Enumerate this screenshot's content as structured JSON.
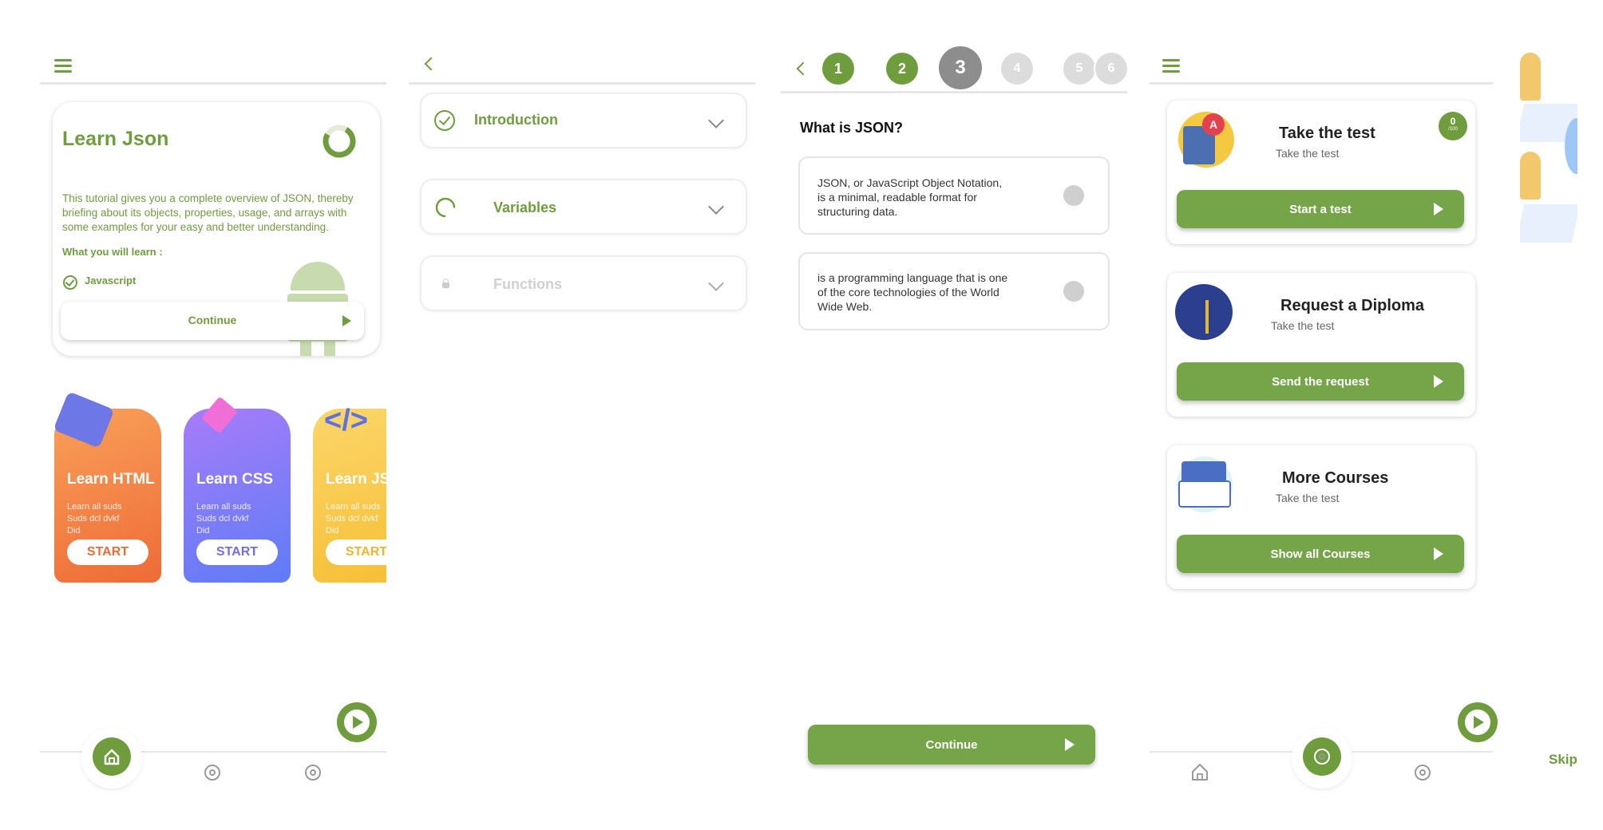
{
  "colors": {
    "accent": "#6f9d3d",
    "button": "#75a548",
    "html_card": "#f07a3c",
    "css_card": "#7c6cf7",
    "js_card": "#f7c844"
  },
  "screen1": {
    "hero": {
      "title": "Learn Json",
      "description": "This tutorial gives you a complete overview of JSON, thereby briefing about its objects, properties, usage, and arrays with some examples for your easy and better understanding.",
      "learn_heading": "What you will learn :",
      "learn_item": "Javascript",
      "continue_label": "Continue"
    },
    "courses": [
      {
        "title": "Learn HTML",
        "desc1": "Learn all suds",
        "desc2": "Suds dcl dvkf",
        "desc3": "Did",
        "start": "START"
      },
      {
        "title": "Learn CSS",
        "desc1": "Learn all suds",
        "desc2": "Suds dcl dvkf",
        "desc3": "Did",
        "start": "START"
      },
      {
        "title": "Learn JS",
        "desc1": "Learn all suds",
        "desc2": "Suds dcl dvkf",
        "desc3": "Did",
        "start": "START"
      }
    ]
  },
  "screen2": {
    "sections": [
      {
        "label": "Introduction",
        "state": "completed"
      },
      {
        "label": "Variables",
        "state": "in-progress"
      },
      {
        "label": "Functions",
        "state": "locked"
      }
    ]
  },
  "screen3": {
    "steps": [
      "1",
      "2",
      "3",
      "4",
      "5",
      "6"
    ],
    "current_step": 3,
    "question": "What is JSON?",
    "answers": [
      "JSON, or JavaScript Object Notation, is a minimal, readable format for structuring data.",
      "is a programming language that is one of the core technologies of the World Wide Web."
    ],
    "continue_label": "Continue"
  },
  "screen4": {
    "cards": [
      {
        "title": "Take the test",
        "subtitle": "Take the test",
        "button": "Start a test",
        "badge_value": "0",
        "badge_unit": "/100"
      },
      {
        "title": "Request a Diploma",
        "subtitle": "Take the test",
        "button": "Send the request"
      },
      {
        "title": "More Courses",
        "subtitle": "Take the test",
        "button": "Show all Courses"
      }
    ]
  },
  "screen5": {
    "skip_label": "Skip"
  }
}
